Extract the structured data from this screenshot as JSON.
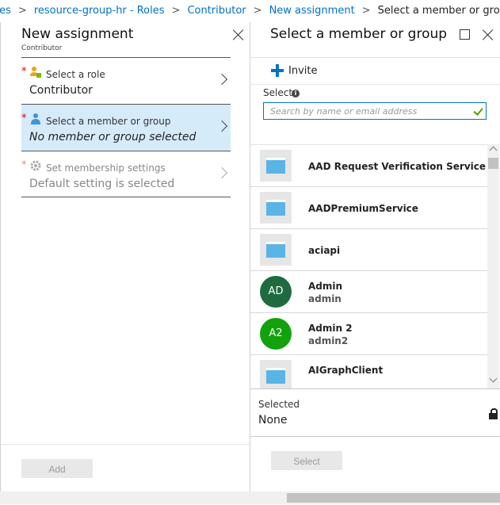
{
  "breadcrumb": {
    "items": [
      "ces",
      "resource-group-hr - Roles",
      "Contributor",
      "New assignment"
    ],
    "current": "Select a member or group",
    "separator": ">"
  },
  "left_blade": {
    "title": "New assignment",
    "subtitle": "Contributor",
    "rows": [
      {
        "label": "Select a role",
        "value": "Contributor",
        "required": "*"
      },
      {
        "label": "Select a member or group",
        "value": "No member or group selected",
        "required": "*"
      },
      {
        "label": "Set membership settings",
        "value": "Default setting is selected",
        "required": "*"
      }
    ],
    "add_label": "Add"
  },
  "right_blade": {
    "title": "Select a member or group",
    "invite_label": "Invite",
    "select_label": "Select",
    "info_glyph": "i",
    "search_placeholder": "Search by name or email address",
    "results": [
      {
        "name": "AAD Request Verification Service - PROD",
        "sub": "",
        "icon": "app-icon"
      },
      {
        "name": "AADPremiumService",
        "sub": "",
        "icon": "app-icon"
      },
      {
        "name": "aciapi",
        "sub": "",
        "icon": "app-icon"
      },
      {
        "name": "Admin",
        "sub": "admin",
        "initials": "AD",
        "avatar_color": "#1e6b3f"
      },
      {
        "name": "Admin 2",
        "sub": "admin2",
        "initials": "A2",
        "avatar_color": "#13a10e"
      },
      {
        "name": "AIGraphClient",
        "sub": "",
        "icon": "app-icon"
      }
    ],
    "selected_label": "Selected",
    "selected_value": "None",
    "select_button_label": "Select"
  },
  "colors": {
    "accent": "#0072c6",
    "selected_row": "#d6ebfa",
    "required": "#e00000",
    "check": "#57a300"
  }
}
